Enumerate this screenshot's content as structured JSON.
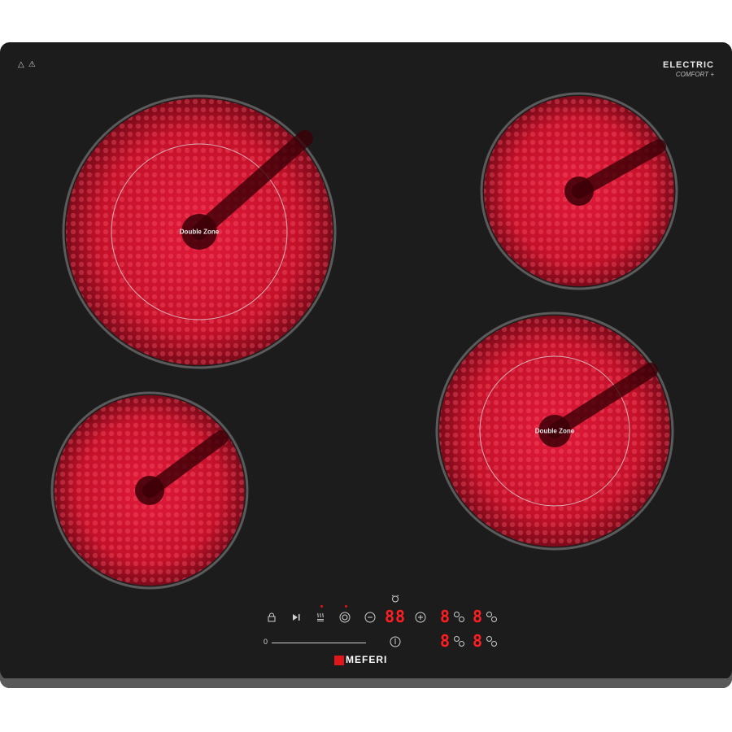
{
  "warning_symbols": "△ ⚠",
  "brand_tag": {
    "line1": "ELECTRIC",
    "line2": "COMFORT +"
  },
  "zones": [
    {
      "id": "top-left",
      "label": "Double Zone"
    },
    {
      "id": "top-right",
      "label": ""
    },
    {
      "id": "bottom-left",
      "label": ""
    },
    {
      "id": "bottom-right",
      "label": "Double Zone"
    }
  ],
  "controls": {
    "timer_display": "88",
    "zone_displays": [
      "8",
      "8",
      "8",
      "8"
    ],
    "slider_min": "0",
    "icons": {
      "lock": "lock-icon",
      "play": "play-pause-icon",
      "warm": "keep-warm-icon",
      "dual": "dual-zone-icon",
      "minus": "minus-icon",
      "plus": "plus-icon",
      "timer": "timer-alarm-icon",
      "power": "power-icon"
    }
  },
  "logo": "MEFERI",
  "colors": {
    "glass": "#1c1c1c",
    "heat": "#c4112a",
    "display": "#ff1e22"
  }
}
